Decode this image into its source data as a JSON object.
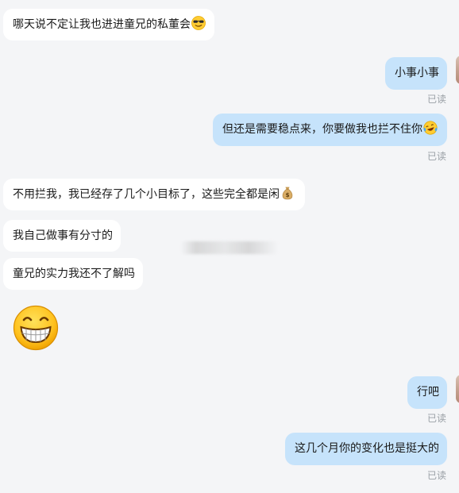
{
  "messages": [
    {
      "text": "哪天说不定让我也进进童兄的私董会"
    },
    {
      "text": "小事小事",
      "status": "已读"
    },
    {
      "text": "但还是需要稳点来，你要做我也拦不住你",
      "status": "已读"
    },
    {
      "text": "不用拦我，我已经存了几个小目标了，这些完全都是闲"
    },
    {
      "text": "我自己做事有分寸的"
    },
    {
      "text": "童兄的实力我还不了解吗"
    },
    {
      "text": "行吧",
      "status": "已读"
    },
    {
      "text": "这几个月你的变化也是挺大的",
      "status": "已读"
    }
  ],
  "icons": {
    "m0": "sunglasses-smile-emoji-icon",
    "m2": "laughing-tears-emoji-icon",
    "m3": "money-bag-emoji-icon",
    "sticker": "grinning-emoji-icon"
  }
}
